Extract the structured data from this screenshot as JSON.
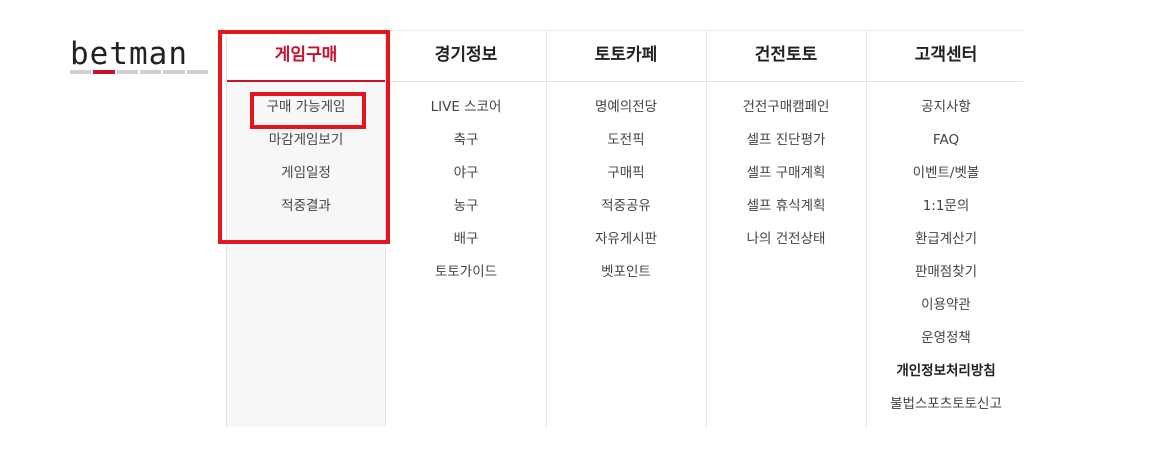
{
  "logo": {
    "text": "betman",
    "accent": "#c8102e"
  },
  "menu": [
    {
      "title": "게임구매",
      "items": [
        "구매 가능게임",
        "마감게임보기",
        "게임일정",
        "적중결과"
      ]
    },
    {
      "title": "경기정보",
      "items": [
        "LIVE 스코어",
        "축구",
        "야구",
        "농구",
        "배구",
        "토토가이드"
      ]
    },
    {
      "title": "토토카페",
      "items": [
        "명예의전당",
        "도전픽",
        "구매픽",
        "적중공유",
        "자유게시판",
        "벳포인트"
      ]
    },
    {
      "title": "건전토토",
      "items": [
        "건전구매캠페인",
        "셀프 진단평가",
        "셀프 구매계획",
        "셀프 휴식계획",
        "나의 건전상태"
      ]
    },
    {
      "title": "고객센터",
      "items": [
        "공지사항",
        "FAQ",
        "이벤트/벳볼",
        "1:1문의",
        "환급계산기",
        "판매점찾기",
        "이용약관",
        "운영정책",
        "개인정보처리방침",
        "불법스포츠토토신고"
      ]
    }
  ],
  "colors": {
    "active": "#c8102e",
    "highlight": "#e3161f"
  }
}
